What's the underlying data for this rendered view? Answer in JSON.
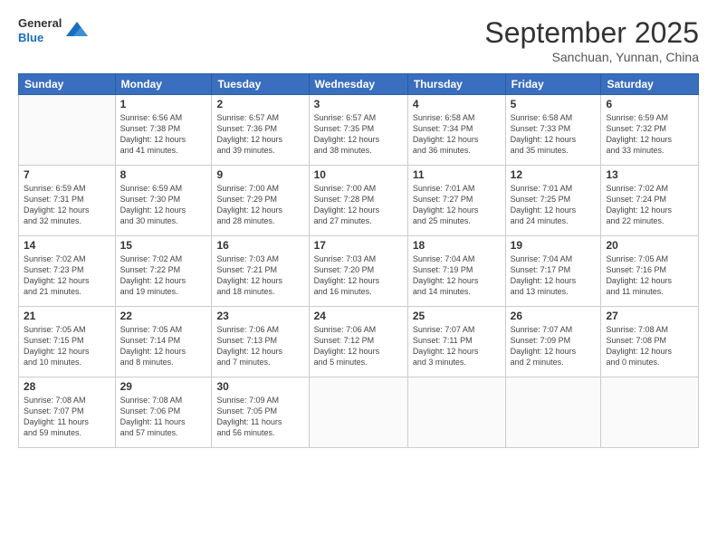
{
  "header": {
    "title": "September 2025",
    "subtitle": "Sanchuan, Yunnan, China"
  },
  "calendar": {
    "headers": [
      "Sunday",
      "Monday",
      "Tuesday",
      "Wednesday",
      "Thursday",
      "Friday",
      "Saturday"
    ],
    "weeks": [
      [
        {
          "day": "",
          "info": ""
        },
        {
          "day": "1",
          "info": "Sunrise: 6:56 AM\nSunset: 7:38 PM\nDaylight: 12 hours\nand 41 minutes."
        },
        {
          "day": "2",
          "info": "Sunrise: 6:57 AM\nSunset: 7:36 PM\nDaylight: 12 hours\nand 39 minutes."
        },
        {
          "day": "3",
          "info": "Sunrise: 6:57 AM\nSunset: 7:35 PM\nDaylight: 12 hours\nand 38 minutes."
        },
        {
          "day": "4",
          "info": "Sunrise: 6:58 AM\nSunset: 7:34 PM\nDaylight: 12 hours\nand 36 minutes."
        },
        {
          "day": "5",
          "info": "Sunrise: 6:58 AM\nSunset: 7:33 PM\nDaylight: 12 hours\nand 35 minutes."
        },
        {
          "day": "6",
          "info": "Sunrise: 6:59 AM\nSunset: 7:32 PM\nDaylight: 12 hours\nand 33 minutes."
        }
      ],
      [
        {
          "day": "7",
          "info": "Sunrise: 6:59 AM\nSunset: 7:31 PM\nDaylight: 12 hours\nand 32 minutes."
        },
        {
          "day": "8",
          "info": "Sunrise: 6:59 AM\nSunset: 7:30 PM\nDaylight: 12 hours\nand 30 minutes."
        },
        {
          "day": "9",
          "info": "Sunrise: 7:00 AM\nSunset: 7:29 PM\nDaylight: 12 hours\nand 28 minutes."
        },
        {
          "day": "10",
          "info": "Sunrise: 7:00 AM\nSunset: 7:28 PM\nDaylight: 12 hours\nand 27 minutes."
        },
        {
          "day": "11",
          "info": "Sunrise: 7:01 AM\nSunset: 7:27 PM\nDaylight: 12 hours\nand 25 minutes."
        },
        {
          "day": "12",
          "info": "Sunrise: 7:01 AM\nSunset: 7:25 PM\nDaylight: 12 hours\nand 24 minutes."
        },
        {
          "day": "13",
          "info": "Sunrise: 7:02 AM\nSunset: 7:24 PM\nDaylight: 12 hours\nand 22 minutes."
        }
      ],
      [
        {
          "day": "14",
          "info": "Sunrise: 7:02 AM\nSunset: 7:23 PM\nDaylight: 12 hours\nand 21 minutes."
        },
        {
          "day": "15",
          "info": "Sunrise: 7:02 AM\nSunset: 7:22 PM\nDaylight: 12 hours\nand 19 minutes."
        },
        {
          "day": "16",
          "info": "Sunrise: 7:03 AM\nSunset: 7:21 PM\nDaylight: 12 hours\nand 18 minutes."
        },
        {
          "day": "17",
          "info": "Sunrise: 7:03 AM\nSunset: 7:20 PM\nDaylight: 12 hours\nand 16 minutes."
        },
        {
          "day": "18",
          "info": "Sunrise: 7:04 AM\nSunset: 7:19 PM\nDaylight: 12 hours\nand 14 minutes."
        },
        {
          "day": "19",
          "info": "Sunrise: 7:04 AM\nSunset: 7:17 PM\nDaylight: 12 hours\nand 13 minutes."
        },
        {
          "day": "20",
          "info": "Sunrise: 7:05 AM\nSunset: 7:16 PM\nDaylight: 12 hours\nand 11 minutes."
        }
      ],
      [
        {
          "day": "21",
          "info": "Sunrise: 7:05 AM\nSunset: 7:15 PM\nDaylight: 12 hours\nand 10 minutes."
        },
        {
          "day": "22",
          "info": "Sunrise: 7:05 AM\nSunset: 7:14 PM\nDaylight: 12 hours\nand 8 minutes."
        },
        {
          "day": "23",
          "info": "Sunrise: 7:06 AM\nSunset: 7:13 PM\nDaylight: 12 hours\nand 7 minutes."
        },
        {
          "day": "24",
          "info": "Sunrise: 7:06 AM\nSunset: 7:12 PM\nDaylight: 12 hours\nand 5 minutes."
        },
        {
          "day": "25",
          "info": "Sunrise: 7:07 AM\nSunset: 7:11 PM\nDaylight: 12 hours\nand 3 minutes."
        },
        {
          "day": "26",
          "info": "Sunrise: 7:07 AM\nSunset: 7:09 PM\nDaylight: 12 hours\nand 2 minutes."
        },
        {
          "day": "27",
          "info": "Sunrise: 7:08 AM\nSunset: 7:08 PM\nDaylight: 12 hours\nand 0 minutes."
        }
      ],
      [
        {
          "day": "28",
          "info": "Sunrise: 7:08 AM\nSunset: 7:07 PM\nDaylight: 11 hours\nand 59 minutes."
        },
        {
          "day": "29",
          "info": "Sunrise: 7:08 AM\nSunset: 7:06 PM\nDaylight: 11 hours\nand 57 minutes."
        },
        {
          "day": "30",
          "info": "Sunrise: 7:09 AM\nSunset: 7:05 PM\nDaylight: 11 hours\nand 56 minutes."
        },
        {
          "day": "",
          "info": ""
        },
        {
          "day": "",
          "info": ""
        },
        {
          "day": "",
          "info": ""
        },
        {
          "day": "",
          "info": ""
        }
      ]
    ]
  }
}
